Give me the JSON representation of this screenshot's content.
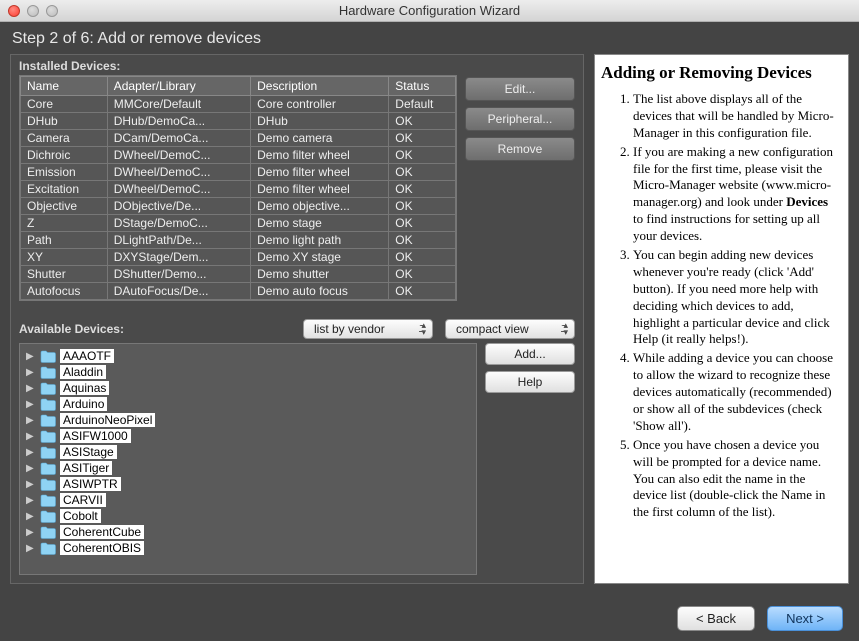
{
  "window": {
    "title": "Hardware Configuration Wizard"
  },
  "step_header": "Step 2 of 6: Add or remove devices",
  "installed": {
    "label": "Installed Devices:",
    "columns": [
      "Name",
      "Adapter/Library",
      "Description",
      "Status"
    ],
    "rows": [
      {
        "name": "Core",
        "adapter": "MMCore/Default",
        "desc": "Core controller",
        "status": "Default"
      },
      {
        "name": "DHub",
        "adapter": "DHub/DemoCa...",
        "desc": "DHub",
        "status": "OK"
      },
      {
        "name": "Camera",
        "adapter": "DCam/DemoCa...",
        "desc": "Demo camera",
        "status": "OK"
      },
      {
        "name": "Dichroic",
        "adapter": "DWheel/DemoC...",
        "desc": "Demo filter wheel",
        "status": "OK"
      },
      {
        "name": "Emission",
        "adapter": "DWheel/DemoC...",
        "desc": "Demo filter wheel",
        "status": "OK"
      },
      {
        "name": "Excitation",
        "adapter": "DWheel/DemoC...",
        "desc": "Demo filter wheel",
        "status": "OK"
      },
      {
        "name": "Objective",
        "adapter": "DObjective/De...",
        "desc": "Demo objective...",
        "status": "OK"
      },
      {
        "name": "Z",
        "adapter": "DStage/DemoC...",
        "desc": "Demo stage",
        "status": "OK"
      },
      {
        "name": "Path",
        "adapter": "DLightPath/De...",
        "desc": "Demo light path",
        "status": "OK"
      },
      {
        "name": "XY",
        "adapter": "DXYStage/Dem...",
        "desc": "Demo XY stage",
        "status": "OK"
      },
      {
        "name": "Shutter",
        "adapter": "DShutter/Demo...",
        "desc": "Demo shutter",
        "status": "OK"
      },
      {
        "name": "Autofocus",
        "adapter": "DAutoFocus/De...",
        "desc": "Demo auto focus",
        "status": "OK"
      }
    ],
    "buttons": {
      "edit": "Edit...",
      "peripheral": "Peripheral...",
      "remove": "Remove"
    }
  },
  "available": {
    "label": "Available Devices:",
    "sort_select": "list by vendor",
    "view_select": "compact view",
    "buttons": {
      "add": "Add...",
      "help": "Help"
    },
    "items": [
      "AAAOTF",
      "Aladdin",
      "Aquinas",
      "Arduino",
      "ArduinoNeoPixel",
      "ASIFW1000",
      "ASIStage",
      "ASITiger",
      "ASIWPTR",
      "CARVII",
      "Cobolt",
      "CoherentCube",
      "CoherentOBIS"
    ]
  },
  "help": {
    "title": "Adding or Removing Devices",
    "items": [
      "The list above displays all of the devices that will be handled by Micro-Manager in this configuration file.",
      "If you are making a new configuration file for the first time, please visit the Micro-Manager website (www.micro-manager.org) and look under Devices to find instructions for setting up all your devices.",
      "You can begin adding new devices whenever you're ready (click 'Add' button). If you need more help with deciding which devices to add, highlight a particular device and click Help (it really helps!).",
      "While adding a device you can choose to allow the wizard to recognize these devices automatically (recommended) or show all of the subdevices (check 'Show all').",
      "Once you have chosen a device you will be prompted for a device name. You can also edit the name in the device list (double-click the Name in the first column of the list)."
    ],
    "bold_word": "Devices"
  },
  "nav": {
    "back": "< Back",
    "next": "Next >"
  }
}
